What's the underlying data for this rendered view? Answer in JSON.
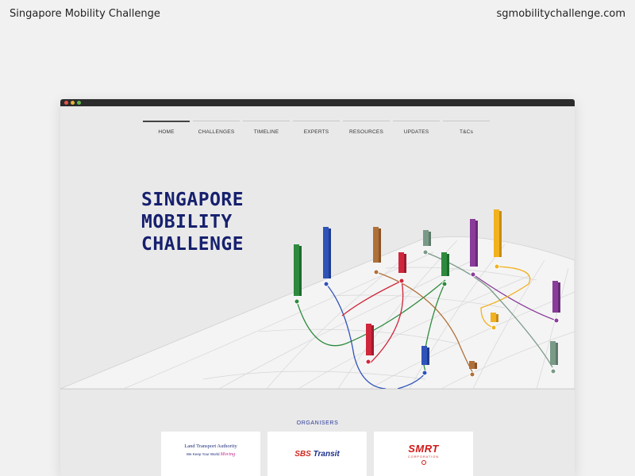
{
  "caption": {
    "left": "Singapore Mobility Challenge",
    "right": "sgmobilitychallenge.com"
  },
  "nav": {
    "items": [
      "HOME",
      "CHALLENGES",
      "TIMELINE",
      "EXPERTS",
      "RESOURCES",
      "UPDATES",
      "T&Cs"
    ],
    "active": "HOME"
  },
  "hero": {
    "title_lines": [
      "SINGAPORE",
      "MOBILITY",
      "CHALLENGE"
    ]
  },
  "organisers": {
    "label": "ORGANISERS",
    "lta": {
      "main": "Land Transport Authority",
      "sub": "We Keep Your World",
      "moving": "Moving"
    },
    "sbs": {
      "part1": "SBS",
      "part2": "Transit"
    },
    "smrt": {
      "main": "SMRT",
      "sub": "CORPORATION"
    }
  },
  "colors": {
    "title": "#16206e",
    "green": "#2e8b3e",
    "blue": "#2f53b8",
    "brown": "#b0703a",
    "red": "#d0263b",
    "purple": "#8a3c9a",
    "yellow": "#f2b11f",
    "grey_green": "#7a9a88"
  }
}
